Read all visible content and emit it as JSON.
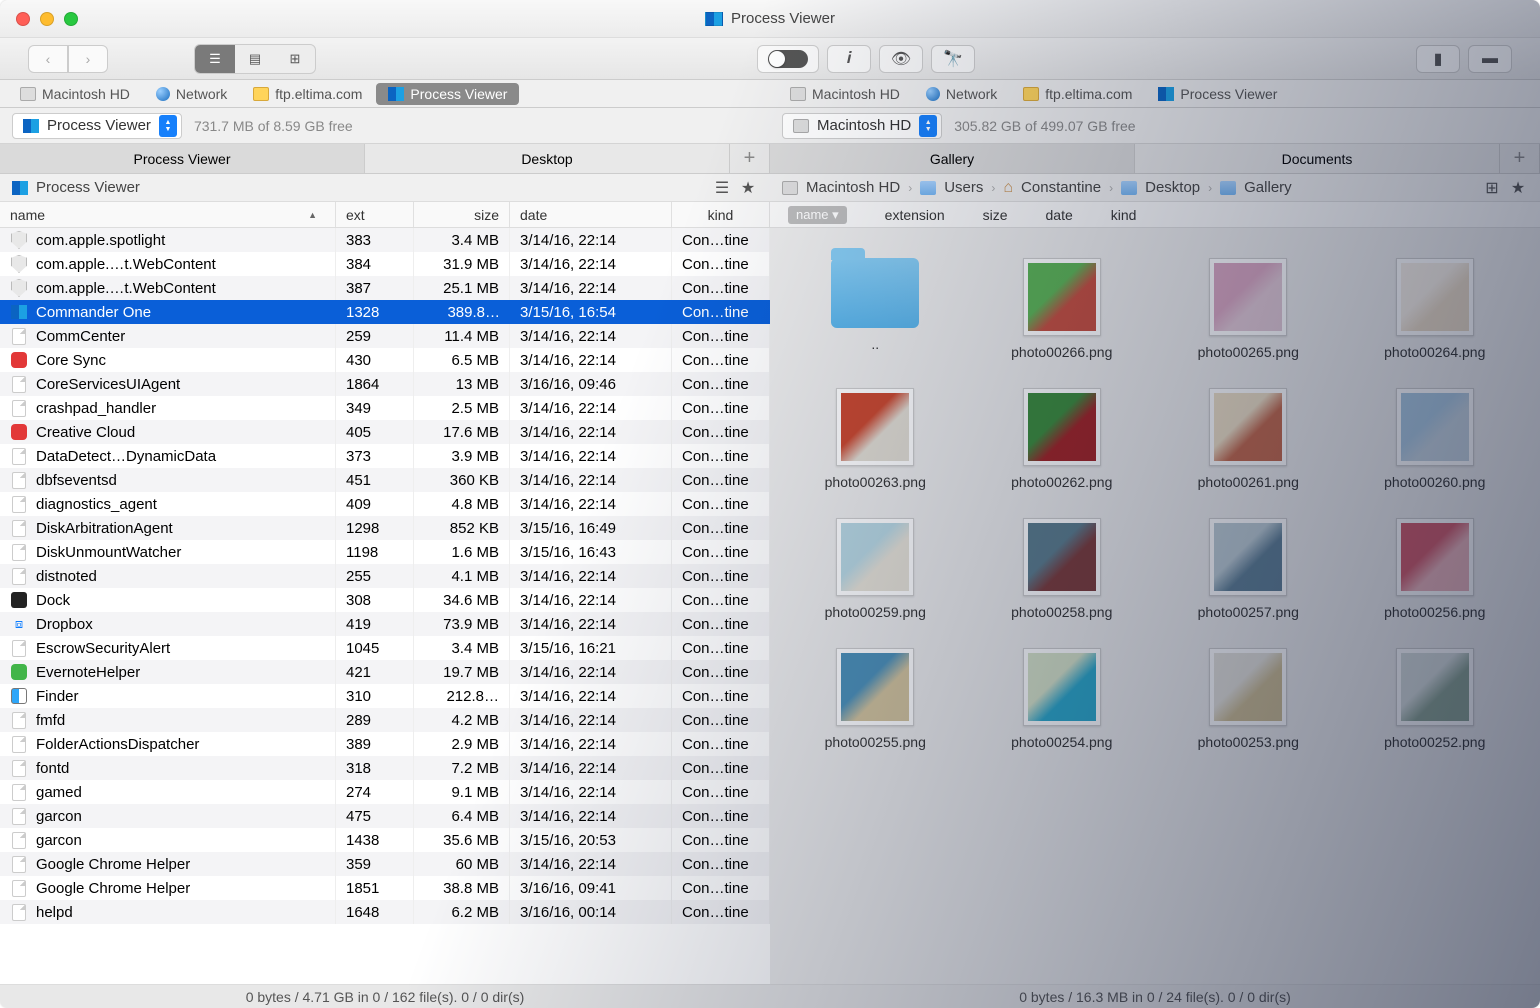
{
  "window": {
    "title": "Process Viewer"
  },
  "left": {
    "tabs": [
      {
        "label": "Macintosh HD",
        "icon": "hd"
      },
      {
        "label": "Network",
        "icon": "net"
      },
      {
        "label": "ftp.eltima.com",
        "icon": "ftp"
      },
      {
        "label": "Process Viewer",
        "icon": "pv",
        "active": true
      }
    ],
    "location": {
      "label": "Process Viewer",
      "disk": "731.7 MB of 8.59 GB free"
    },
    "panelTabs": {
      "active": "Process Viewer",
      "inactive": "Desktop"
    },
    "breadcrumb": {
      "label": "Process Viewer"
    },
    "columns": {
      "name": "name",
      "ext": "ext",
      "size": "size",
      "date": "date",
      "kind": "kind"
    },
    "files": [
      {
        "name": "com.apple.spotlight",
        "ext": "383",
        "size": "3.4 MB",
        "date": "3/14/16, 22:14",
        "kind": "Con…tine",
        "icon": "shield"
      },
      {
        "name": "com.apple.…t.WebContent",
        "ext": "384",
        "size": "31.9 MB",
        "date": "3/14/16, 22:14",
        "kind": "Con…tine",
        "icon": "shield"
      },
      {
        "name": "com.apple.…t.WebContent",
        "ext": "387",
        "size": "25.1 MB",
        "date": "3/14/16, 22:14",
        "kind": "Con…tine",
        "icon": "shield"
      },
      {
        "name": "Commander One",
        "ext": "1328",
        "size": "389.8…",
        "date": "3/15/16, 16:54",
        "kind": "Con…tine",
        "icon": "pv",
        "selected": true
      },
      {
        "name": "CommCenter",
        "ext": "259",
        "size": "11.4 MB",
        "date": "3/14/16, 22:14",
        "kind": "Con…tine",
        "icon": "gen"
      },
      {
        "name": "Core Sync",
        "ext": "430",
        "size": "6.5 MB",
        "date": "3/14/16, 22:14",
        "kind": "Con…tine",
        "icon": "appred"
      },
      {
        "name": "CoreServicesUIAgent",
        "ext": "1864",
        "size": "13 MB",
        "date": "3/16/16, 09:46",
        "kind": "Con…tine",
        "icon": "gen"
      },
      {
        "name": "crashpad_handler",
        "ext": "349",
        "size": "2.5 MB",
        "date": "3/14/16, 22:14",
        "kind": "Con…tine",
        "icon": "gen"
      },
      {
        "name": "Creative Cloud",
        "ext": "405",
        "size": "17.6 MB",
        "date": "3/14/16, 22:14",
        "kind": "Con…tine",
        "icon": "appred"
      },
      {
        "name": "DataDetect…DynamicData",
        "ext": "373",
        "size": "3.9 MB",
        "date": "3/14/16, 22:14",
        "kind": "Con…tine",
        "icon": "gen"
      },
      {
        "name": "dbfseventsd",
        "ext": "451",
        "size": "360 KB",
        "date": "3/14/16, 22:14",
        "kind": "Con…tine",
        "icon": "gen"
      },
      {
        "name": "diagnostics_agent",
        "ext": "409",
        "size": "4.8 MB",
        "date": "3/14/16, 22:14",
        "kind": "Con…tine",
        "icon": "gen"
      },
      {
        "name": "DiskArbitrationAgent",
        "ext": "1298",
        "size": "852 KB",
        "date": "3/15/16, 16:49",
        "kind": "Con…tine",
        "icon": "gen"
      },
      {
        "name": "DiskUnmountWatcher",
        "ext": "1198",
        "size": "1.6 MB",
        "date": "3/15/16, 16:43",
        "kind": "Con…tine",
        "icon": "gen"
      },
      {
        "name": "distnoted",
        "ext": "255",
        "size": "4.1 MB",
        "date": "3/14/16, 22:14",
        "kind": "Con…tine",
        "icon": "gen"
      },
      {
        "name": "Dock",
        "ext": "308",
        "size": "34.6 MB",
        "date": "3/14/16, 22:14",
        "kind": "Con…tine",
        "icon": "dock"
      },
      {
        "name": "Dropbox",
        "ext": "419",
        "size": "73.9 MB",
        "date": "3/14/16, 22:14",
        "kind": "Con…tine",
        "icon": "db"
      },
      {
        "name": "EscrowSecurityAlert",
        "ext": "1045",
        "size": "3.4 MB",
        "date": "3/15/16, 16:21",
        "kind": "Con…tine",
        "icon": "gen"
      },
      {
        "name": "EvernoteHelper",
        "ext": "421",
        "size": "19.7 MB",
        "date": "3/14/16, 22:14",
        "kind": "Con…tine",
        "icon": "appgrn"
      },
      {
        "name": "Finder",
        "ext": "310",
        "size": "212.8…",
        "date": "3/14/16, 22:14",
        "kind": "Con…tine",
        "icon": "finder"
      },
      {
        "name": "fmfd",
        "ext": "289",
        "size": "4.2 MB",
        "date": "3/14/16, 22:14",
        "kind": "Con…tine",
        "icon": "gen"
      },
      {
        "name": "FolderActionsDispatcher",
        "ext": "389",
        "size": "2.9 MB",
        "date": "3/14/16, 22:14",
        "kind": "Con…tine",
        "icon": "gen"
      },
      {
        "name": "fontd",
        "ext": "318",
        "size": "7.2 MB",
        "date": "3/14/16, 22:14",
        "kind": "Con…tine",
        "icon": "gen"
      },
      {
        "name": "gamed",
        "ext": "274",
        "size": "9.1 MB",
        "date": "3/14/16, 22:14",
        "kind": "Con…tine",
        "icon": "gen"
      },
      {
        "name": "garcon",
        "ext": "475",
        "size": "6.4 MB",
        "date": "3/14/16, 22:14",
        "kind": "Con…tine",
        "icon": "gen"
      },
      {
        "name": "garcon",
        "ext": "1438",
        "size": "35.6 MB",
        "date": "3/15/16, 20:53",
        "kind": "Con…tine",
        "icon": "gen"
      },
      {
        "name": "Google Chrome Helper",
        "ext": "359",
        "size": "60 MB",
        "date": "3/14/16, 22:14",
        "kind": "Con…tine",
        "icon": "gen"
      },
      {
        "name": "Google Chrome Helper",
        "ext": "1851",
        "size": "38.8 MB",
        "date": "3/16/16, 09:41",
        "kind": "Con…tine",
        "icon": "gen"
      },
      {
        "name": "helpd",
        "ext": "1648",
        "size": "6.2 MB",
        "date": "3/16/16, 00:14",
        "kind": "Con…tine",
        "icon": "gen"
      }
    ],
    "status": "0 bytes / 4.71 GB in 0 / 162 file(s). 0 / 0 dir(s)"
  },
  "right": {
    "tabs": [
      {
        "label": "Macintosh HD",
        "icon": "hd"
      },
      {
        "label": "Network",
        "icon": "net"
      },
      {
        "label": "ftp.eltima.com",
        "icon": "ftp"
      },
      {
        "label": "Process Viewer",
        "icon": "pv"
      }
    ],
    "location": {
      "label": "Macintosh HD",
      "disk": "305.82 GB of 499.07 GB free"
    },
    "panelTabs": {
      "active": "Gallery",
      "inactive": "Documents"
    },
    "breadcrumb": [
      {
        "label": "Macintosh HD",
        "icon": "hd"
      },
      {
        "label": "Users",
        "icon": "folder"
      },
      {
        "label": "Constantine",
        "icon": "house"
      },
      {
        "label": "Desktop",
        "icon": "folder"
      },
      {
        "label": "Gallery",
        "icon": "folder"
      }
    ],
    "columns": {
      "name": "name",
      "ext": "extension",
      "size": "size",
      "date": "date",
      "kind": "kind"
    },
    "gallery": [
      {
        "label": "..",
        "type": "folder"
      },
      {
        "label": "photo00266.png",
        "c1": "#5bb354",
        "c2": "#c34d3f"
      },
      {
        "label": "photo00265.png",
        "c1": "#d9a6c1",
        "c2": "#e2c9d6"
      },
      {
        "label": "photo00264.png",
        "c1": "#f6efe6",
        "c2": "#e8d9c4"
      },
      {
        "label": "photo00263.png",
        "c1": "#c8472e",
        "c2": "#e0dcd2"
      },
      {
        "label": "photo00262.png",
        "c1": "#3a8a3b",
        "c2": "#9f2224"
      },
      {
        "label": "photo00261.png",
        "c1": "#eddfc5",
        "c2": "#c2674a"
      },
      {
        "label": "photo00260.png",
        "c1": "#a9c8e0",
        "c2": "#c4d3df"
      },
      {
        "label": "photo00259.png",
        "c1": "#b7d7e2",
        "c2": "#e5e1d6"
      },
      {
        "label": "photo00258.png",
        "c1": "#5a7c8c",
        "c2": "#7a3a3a"
      },
      {
        "label": "photo00257.png",
        "c1": "#bcccd4",
        "c2": "#5d7e94"
      },
      {
        "label": "photo00256.png",
        "c1": "#d05868",
        "c2": "#e9b1b8"
      },
      {
        "label": "photo00255.png",
        "c1": "#4b90b8",
        "c2": "#d2c39c"
      },
      {
        "label": "photo00254.png",
        "c1": "#d6e3c8",
        "c2": "#2aa7c9"
      },
      {
        "label": "photo00253.png",
        "c1": "#e5e3dc",
        "c2": "#cdbd92"
      },
      {
        "label": "photo00252.png",
        "c1": "#d8dfdd",
        "c2": "#8aa391"
      }
    ],
    "status": "0 bytes / 16.3 MB in 0 / 24 file(s). 0 / 0 dir(s)"
  }
}
